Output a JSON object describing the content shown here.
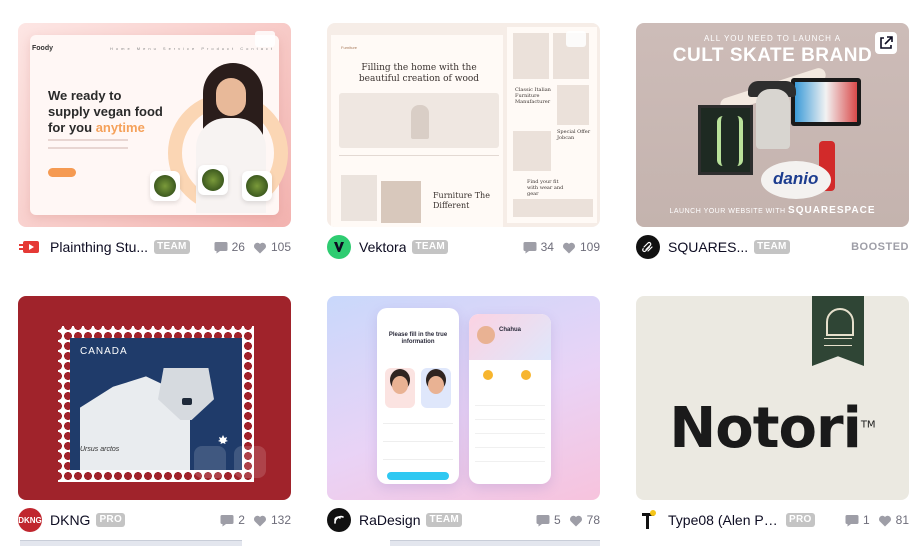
{
  "shots": [
    {
      "author": "Plainthing Stu...",
      "badge": "TEAM",
      "comments": "26",
      "likes": "105",
      "thumb": {
        "brand": "Foody",
        "nav": "Home  Menu  Service  Product  Contact",
        "headline_1": "We ready to",
        "headline_2": "supply vegan food",
        "headline_3": "for you",
        "headline_accent": "anytime"
      }
    },
    {
      "author": "Vektora",
      "badge": "TEAM",
      "comments": "34",
      "likes": "109",
      "thumb": {
        "brand": "Furniture",
        "headline": "Filling the home with the beautiful creation of wood",
        "sub": "Furniture The Different",
        "side_1": "Classic Italian Furniture Manufacturer",
        "side_2": "Special Offer Jobcan",
        "side_3": "Find your fit with wear and gear"
      }
    },
    {
      "author": "SQUARES...",
      "badge": "TEAM",
      "boosted": "BOOSTED",
      "thumb": {
        "small": "ALL YOU NEED TO LAUNCH A",
        "big": "CULT SKATE BRAND",
        "foot": "LAUNCH YOUR WEBSITE WITH",
        "foot_brand": "SQUARESPACE",
        "ball": "danio"
      }
    },
    {
      "author": "DKNG",
      "badge": "PRO",
      "comments": "2",
      "likes": "132",
      "avatar_text": "DKNG",
      "thumb": {
        "country": "CANADA",
        "latin": "Ursus arctos"
      }
    },
    {
      "author": "RaDesign",
      "badge": "TEAM",
      "comments": "5",
      "likes": "78",
      "thumb": {
        "title_1": "Please fill in the true",
        "title_2": "information",
        "profile_name": "Chahua"
      }
    },
    {
      "author": "Type08 (Alen Pavl...",
      "badge": "PRO",
      "comments": "1",
      "likes": "81",
      "thumb": {
        "word": "Notori",
        "tm": "TM"
      }
    }
  ],
  "colors": {
    "badge_bg": "#c4c4c4",
    "stat_text": "#6e6d7a",
    "author_text": "#0d0c22"
  }
}
